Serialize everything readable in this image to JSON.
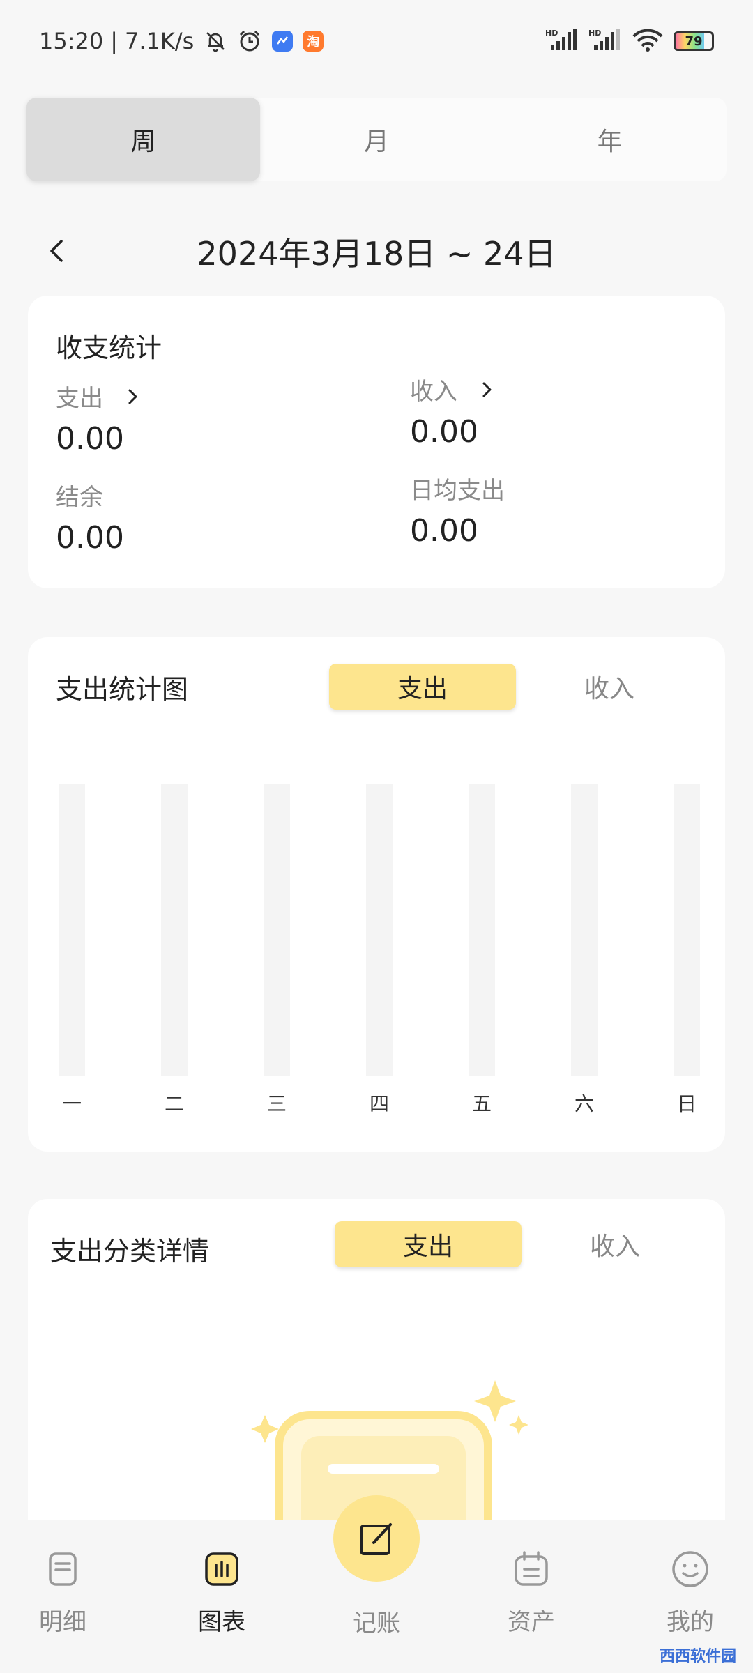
{
  "status_bar": {
    "time": "15:20",
    "net_speed": "7.1K/s",
    "battery": "79",
    "app_chip_1": "",
    "app_chip_2": "淘",
    "signal_1": "HD",
    "signal_2": "HD"
  },
  "period_tabs": [
    {
      "label": "周",
      "active": true
    },
    {
      "label": "月",
      "active": false
    },
    {
      "label": "年",
      "active": false
    }
  ],
  "date_range": "2024年3月18日  ~  24日",
  "summary": {
    "title": "收支统计",
    "expense_label": "支出",
    "expense_value": "0.00",
    "income_label": "收入",
    "income_value": "0.00",
    "balance_label": "结余",
    "balance_value": "0.00",
    "daily_avg_label": "日均支出",
    "daily_avg_value": "0.00"
  },
  "chart_card": {
    "title": "支出统计图",
    "seg_active": "支出",
    "seg_inactive": "收入"
  },
  "chart_data": {
    "type": "bar",
    "categories": [
      "一",
      "二",
      "三",
      "四",
      "五",
      "六",
      "日"
    ],
    "values": [
      0,
      0,
      0,
      0,
      0,
      0,
      0
    ]
  },
  "category_card": {
    "title": "支出分类详情",
    "seg_active": "支出",
    "seg_inactive": "收入"
  },
  "bottom_nav": {
    "items": [
      {
        "label": "明细"
      },
      {
        "label": "图表"
      },
      {
        "label": "记账"
      },
      {
        "label": "资产"
      },
      {
        "label": "我的"
      }
    ]
  },
  "watermark": "西西软件园"
}
